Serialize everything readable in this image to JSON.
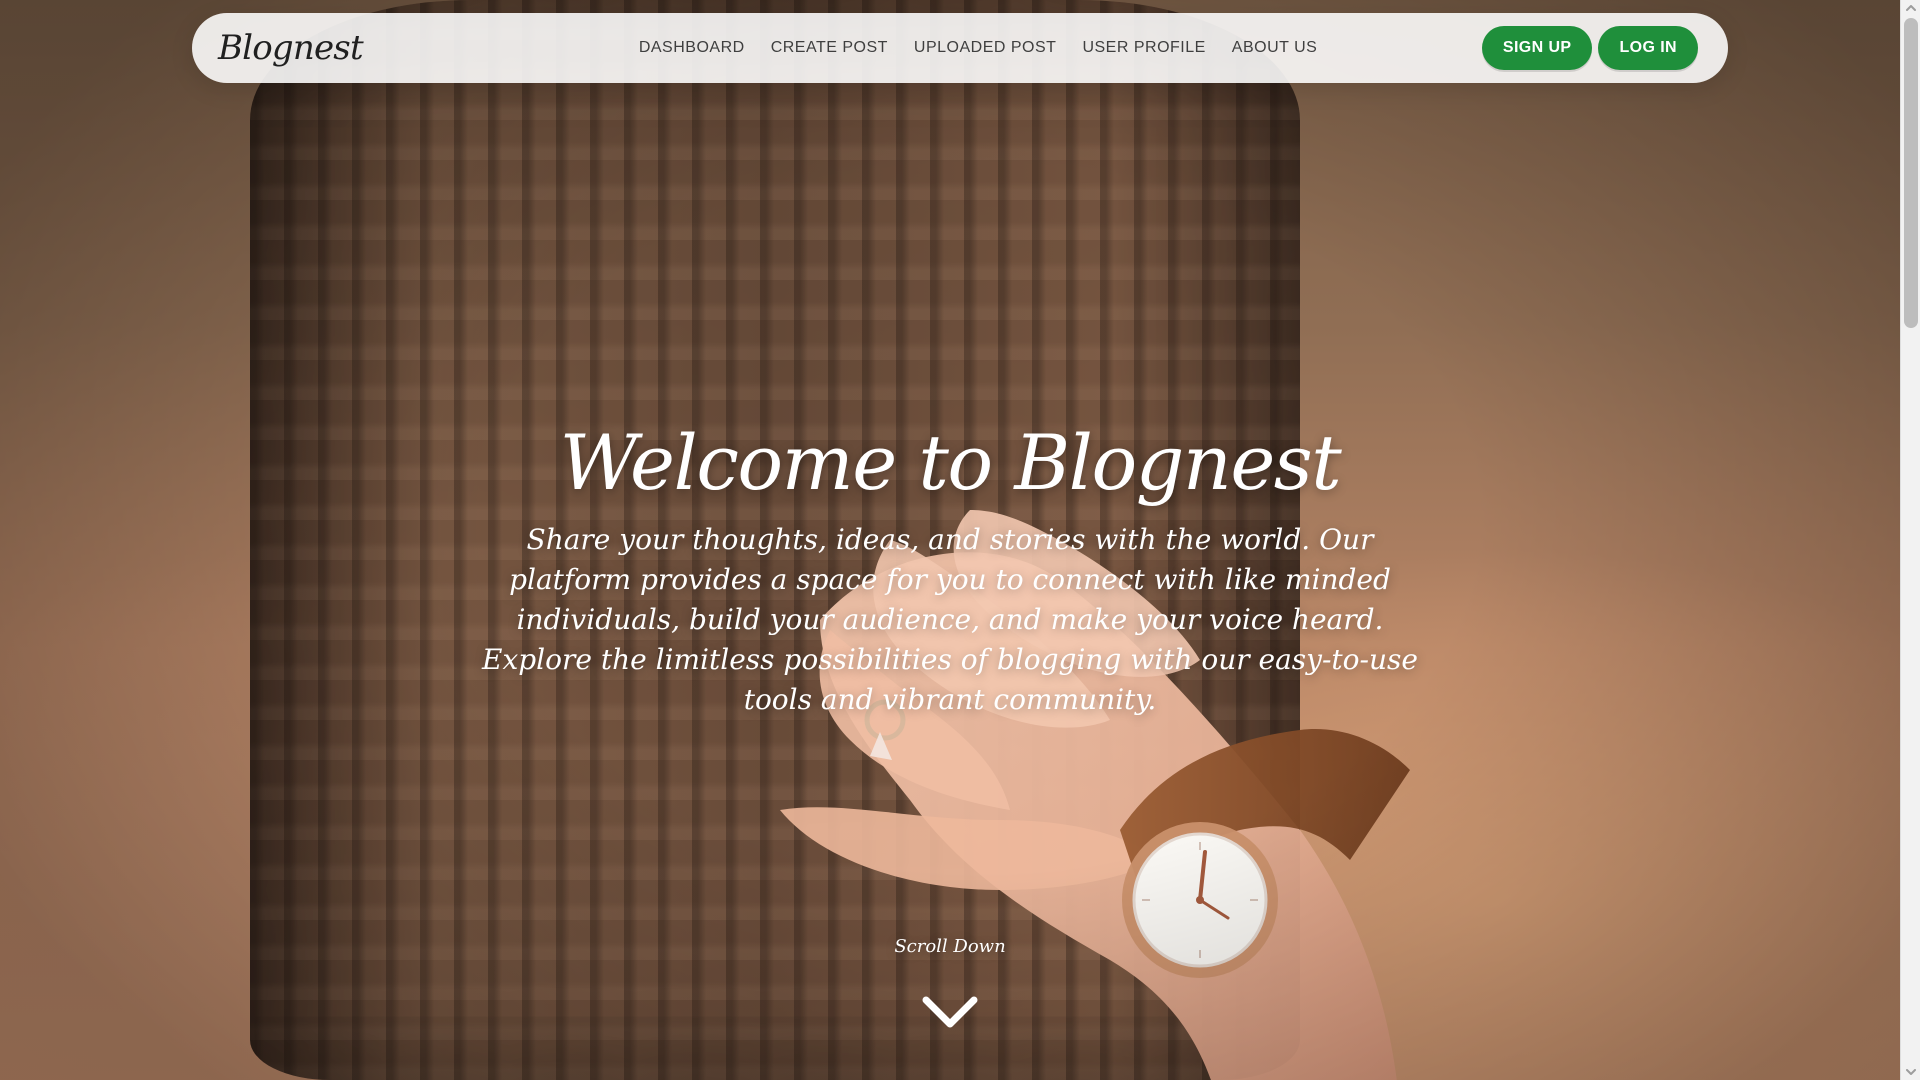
{
  "nav": {
    "brand": "Blognest",
    "links": [
      {
        "label": "DASHBOARD"
      },
      {
        "label": "CREATE POST"
      },
      {
        "label": "UPLOADED POST"
      },
      {
        "label": "USER PROFILE"
      },
      {
        "label": "ABOUT US"
      }
    ],
    "actions": {
      "signup": "SIGN UP",
      "login": "LOG IN"
    }
  },
  "hero": {
    "title": "Welcome to Blognest",
    "subtitle": "Share your thoughts, ideas, and stories with the world. Our platform provides a space for you to connect with like minded individuals, build your audience, and make your voice heard. Explore the limitless possibilities of blogging with our easy-to-use tools and vibrant community.",
    "scroll_label": "Scroll Down"
  },
  "colors": {
    "accent_green": "#1f8f3b",
    "nav_bg": "rgba(255,255,255,0.88)",
    "text_dark": "#202020",
    "text_light": "#ffffff"
  },
  "icons": {
    "scroll_down": "chevron-down-icon",
    "scrollbar_up": "scroll-up-arrow-icon",
    "scrollbar_down": "scroll-down-arrow-icon"
  }
}
